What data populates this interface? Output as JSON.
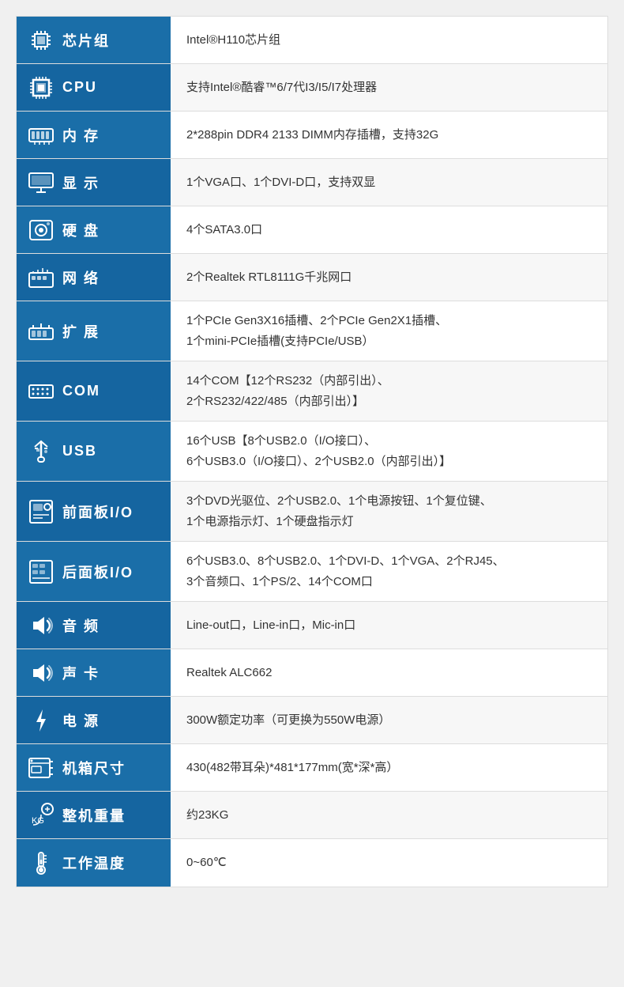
{
  "rows": [
    {
      "id": "chipset",
      "label": "芯片组",
      "icon_type": "chip",
      "value": "Intel®H110芯片组"
    },
    {
      "id": "cpu",
      "label": "CPU",
      "icon_type": "cpu",
      "value": "支持Intel®酷睿™6/7代I3/I5/I7处理器"
    },
    {
      "id": "memory",
      "label": "内  存",
      "icon_type": "ram",
      "value": "2*288pin DDR4 2133 DIMM内存插槽，支持32G"
    },
    {
      "id": "display",
      "label": "显  示",
      "icon_type": "display",
      "value": "1个VGA口、1个DVI-D口，支持双显"
    },
    {
      "id": "hdd",
      "label": "硬  盘",
      "icon_type": "hdd",
      "value": "4个SATA3.0口"
    },
    {
      "id": "network",
      "label": "网  络",
      "icon_type": "network",
      "value": "2个Realtek RTL8111G千兆网口"
    },
    {
      "id": "expansion",
      "label": "扩  展",
      "icon_type": "expand",
      "value": "1个PCIe Gen3X16插槽、2个PCIe Gen2X1插槽、\n1个mini-PCIe插槽(支持PCIe/USB）"
    },
    {
      "id": "com",
      "label": "COM",
      "icon_type": "com",
      "value": "14个COM【12个RS232（内部引出）、\n2个RS232/422/485（内部引出）】"
    },
    {
      "id": "usb",
      "label": "USB",
      "icon_type": "usb",
      "value": "16个USB【8个USB2.0（I/O接口）、\n6个USB3.0（I/O接口）、2个USB2.0（内部引出）】"
    },
    {
      "id": "front-io",
      "label": "前面板I/O",
      "icon_type": "front",
      "value": "3个DVD光驱位、2个USB2.0、1个电源按钮、1个复位键、\n1个电源指示灯、1个硬盘指示灯"
    },
    {
      "id": "rear-io",
      "label": "后面板I/O",
      "icon_type": "rear",
      "value": "6个USB3.0、8个USB2.0、1个DVI-D、1个VGA、2个RJ45、\n3个音频口、1个PS/2、14个COM口"
    },
    {
      "id": "audio",
      "label": "音  频",
      "icon_type": "audio",
      "value": "Line-out口，Line-in口，Mic-in口"
    },
    {
      "id": "soundcard",
      "label": "声  卡",
      "icon_type": "soundcard",
      "value": "Realtek ALC662"
    },
    {
      "id": "power",
      "label": "电  源",
      "icon_type": "power",
      "value": "300W额定功率（可更换为550W电源）"
    },
    {
      "id": "chassis",
      "label": "机箱尺寸",
      "icon_type": "chassis",
      "value": "430(482带耳朵)*481*177mm(宽*深*高）"
    },
    {
      "id": "weight",
      "label": "整机重量",
      "icon_type": "weight",
      "value": "约23KG"
    },
    {
      "id": "temp",
      "label": "工作温度",
      "icon_type": "temp",
      "value": "0~60℃"
    }
  ],
  "icons": {
    "chip": "chip-icon",
    "cpu": "cpu-icon",
    "ram": "ram-icon",
    "display": "display-icon",
    "hdd": "hdd-icon",
    "network": "network-icon",
    "expand": "expand-icon",
    "com": "com-icon",
    "usb": "usb-icon",
    "front": "front-io-icon",
    "rear": "rear-io-icon",
    "audio": "audio-icon",
    "soundcard": "soundcard-icon",
    "power": "power-icon",
    "chassis": "chassis-icon",
    "weight": "weight-icon",
    "temp": "temp-icon"
  }
}
